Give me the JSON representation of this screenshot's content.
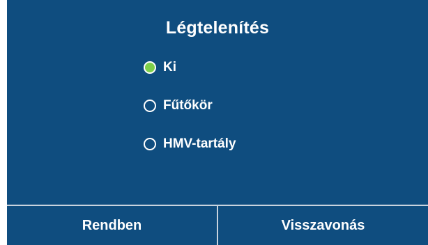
{
  "dialog": {
    "title": "Légtelenítés",
    "options": [
      {
        "label": "Ki",
        "selected": true
      },
      {
        "label": "Fűtőkör",
        "selected": false
      },
      {
        "label": "HMV-tartály",
        "selected": false
      }
    ],
    "buttons": {
      "ok_label": "Rendben",
      "cancel_label": "Visszavonás"
    }
  },
  "colors": {
    "panel_background": "#0f4d7f",
    "selected_radio": "#7ed04b",
    "divider": "#c8d3de",
    "text": "#ffffff"
  }
}
